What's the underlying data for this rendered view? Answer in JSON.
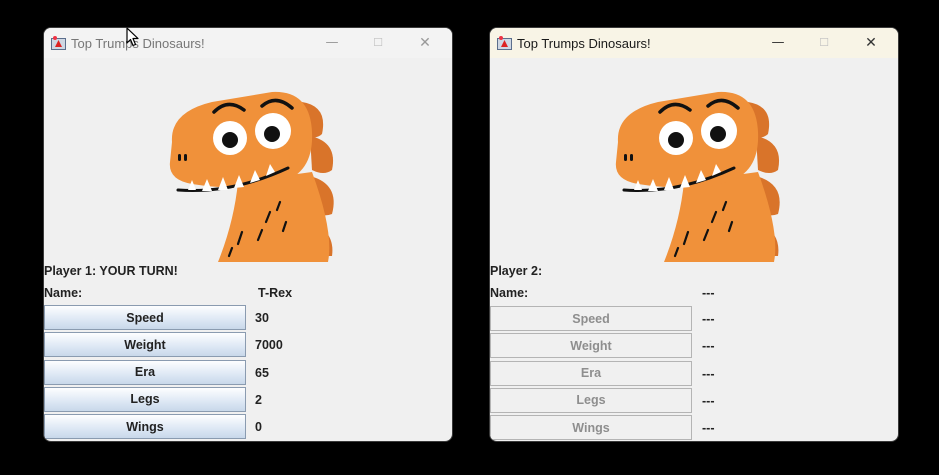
{
  "windows": [
    {
      "title": "Top Trumps Dinosaurs!",
      "player_label": "Player 1: YOUR TURN!",
      "name_label": "Name:",
      "name_value": "T-Rex",
      "controls": {
        "minimize": "—",
        "maximize": "☐",
        "close": "✕"
      },
      "stats": [
        {
          "label": "Speed",
          "value": "30"
        },
        {
          "label": "Weight",
          "value": "7000"
        },
        {
          "label": "Era",
          "value": "65"
        },
        {
          "label": "Legs",
          "value": "2"
        },
        {
          "label": "Wings",
          "value": "0"
        }
      ],
      "buttons_enabled": true
    },
    {
      "title": "Top Trumps Dinosaurs!",
      "player_label": "Player 2:",
      "name_label": "Name:",
      "name_value": "---",
      "controls": {
        "minimize": "—",
        "maximize": "☐",
        "close": "✕"
      },
      "stats": [
        {
          "label": "Speed",
          "value": "---"
        },
        {
          "label": "Weight",
          "value": "---"
        },
        {
          "label": "Era",
          "value": "---"
        },
        {
          "label": "Legs",
          "value": "---"
        },
        {
          "label": "Wings",
          "value": "---"
        }
      ],
      "buttons_enabled": false
    }
  ],
  "colors": {
    "dino_orange": "#f0913a",
    "dino_spikes": "#d9742a",
    "button_border": "#8a9bb0",
    "disabled_text": "#8e8e8e"
  },
  "icons": [
    "java-app-icon",
    "minimize-icon",
    "maximize-icon",
    "close-icon",
    "dinosaur-illustration",
    "mouse-cursor-icon"
  ]
}
